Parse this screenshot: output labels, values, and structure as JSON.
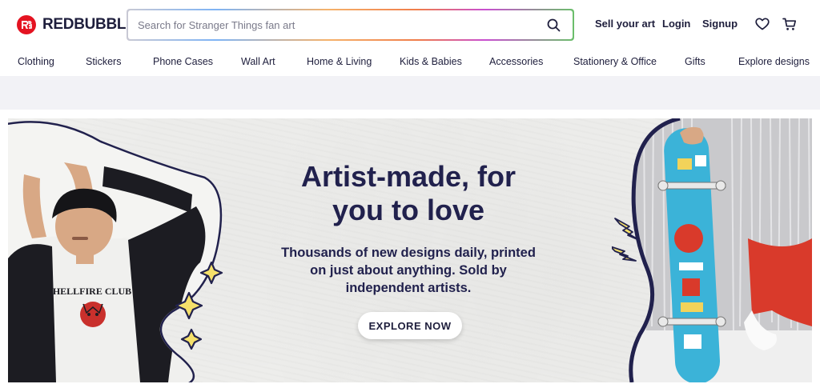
{
  "brand": {
    "name": "REDBUBBLE",
    "accent": "#e41321",
    "ink": "#21214d"
  },
  "search": {
    "placeholder": "Search for Stranger Things fan art",
    "icon": "search-icon"
  },
  "header_links": {
    "sell": "Sell your art",
    "login": "Login",
    "signup": "Signup"
  },
  "header_icons": [
    "heart-icon",
    "cart-icon"
  ],
  "nav": {
    "items": [
      "Clothing",
      "Stickers",
      "Phone Cases",
      "Wall Art",
      "Home & Living",
      "Kids & Babies",
      "Accessories",
      "Stationery & Office",
      "Gifts",
      "Explore designs"
    ]
  },
  "hero": {
    "title_line1": "Artist-made, for",
    "title_line2": "you to love",
    "subtitle_line1": "Thousands of new designs daily, printed",
    "subtitle_line2": "on just about anything. Sold by",
    "subtitle_line3": "independent artists.",
    "cta": "EXPLORE NOW",
    "tshirt_text": "HELLFIRE CLUB"
  }
}
